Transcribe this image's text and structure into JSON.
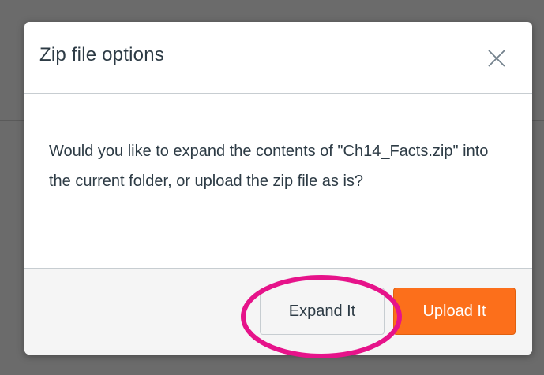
{
  "dialog": {
    "title": "Zip file options",
    "close_icon": "close-icon",
    "message": "Would you like to expand the contents of \"Ch14_Facts.zip\" into the current folder, or upload the zip file as is?",
    "expand_label": "Expand It",
    "upload_label": "Upload It"
  },
  "colors": {
    "primary_button": "#fc6f1b",
    "highlight_annotation": "#e6138a",
    "backdrop": "#6b6b6b"
  }
}
